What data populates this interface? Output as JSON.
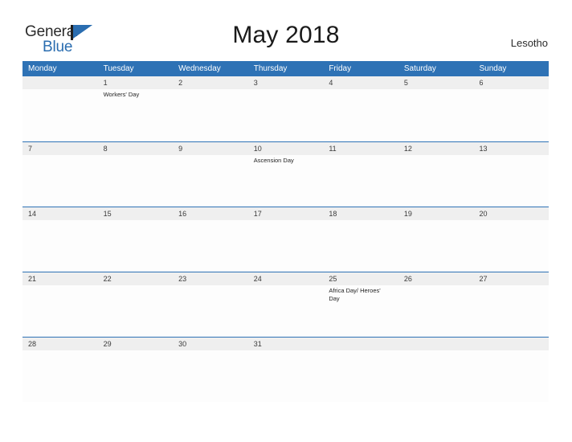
{
  "logo": {
    "word_one": "General",
    "word_two": "Blue",
    "flag_icon": "blue-triangle-flag-icon",
    "flag_color": "#2a6db0"
  },
  "header": {
    "title": "May 2018",
    "country": "Lesotho"
  },
  "colors": {
    "header_blue": "#2e72b5",
    "daynum_band": "#efefef",
    "cell_background": "#fdfdfd",
    "page_background": "#ffffff",
    "text": "#222222",
    "logo_blue": "#2a6db0"
  },
  "calendar": {
    "month": "May",
    "year": "2018",
    "weekday_headers": [
      "Monday",
      "Tuesday",
      "Wednesday",
      "Thursday",
      "Friday",
      "Saturday",
      "Sunday"
    ],
    "weeks": [
      {
        "days": [
          {
            "num": "",
            "events": []
          },
          {
            "num": "1",
            "events": [
              "Workers' Day"
            ]
          },
          {
            "num": "2",
            "events": []
          },
          {
            "num": "3",
            "events": []
          },
          {
            "num": "4",
            "events": []
          },
          {
            "num": "5",
            "events": []
          },
          {
            "num": "6",
            "events": []
          }
        ]
      },
      {
        "days": [
          {
            "num": "7",
            "events": []
          },
          {
            "num": "8",
            "events": []
          },
          {
            "num": "9",
            "events": []
          },
          {
            "num": "10",
            "events": [
              "Ascension Day"
            ]
          },
          {
            "num": "11",
            "events": []
          },
          {
            "num": "12",
            "events": []
          },
          {
            "num": "13",
            "events": []
          }
        ]
      },
      {
        "days": [
          {
            "num": "14",
            "events": []
          },
          {
            "num": "15",
            "events": []
          },
          {
            "num": "16",
            "events": []
          },
          {
            "num": "17",
            "events": []
          },
          {
            "num": "18",
            "events": []
          },
          {
            "num": "19",
            "events": []
          },
          {
            "num": "20",
            "events": []
          }
        ]
      },
      {
        "days": [
          {
            "num": "21",
            "events": []
          },
          {
            "num": "22",
            "events": []
          },
          {
            "num": "23",
            "events": []
          },
          {
            "num": "24",
            "events": []
          },
          {
            "num": "25",
            "events": [
              "Africa Day/ Heroes' Day"
            ]
          },
          {
            "num": "26",
            "events": []
          },
          {
            "num": "27",
            "events": []
          }
        ]
      },
      {
        "days": [
          {
            "num": "28",
            "events": []
          },
          {
            "num": "29",
            "events": []
          },
          {
            "num": "30",
            "events": []
          },
          {
            "num": "31",
            "events": []
          },
          {
            "num": "",
            "events": []
          },
          {
            "num": "",
            "events": []
          },
          {
            "num": "",
            "events": []
          }
        ]
      }
    ]
  }
}
